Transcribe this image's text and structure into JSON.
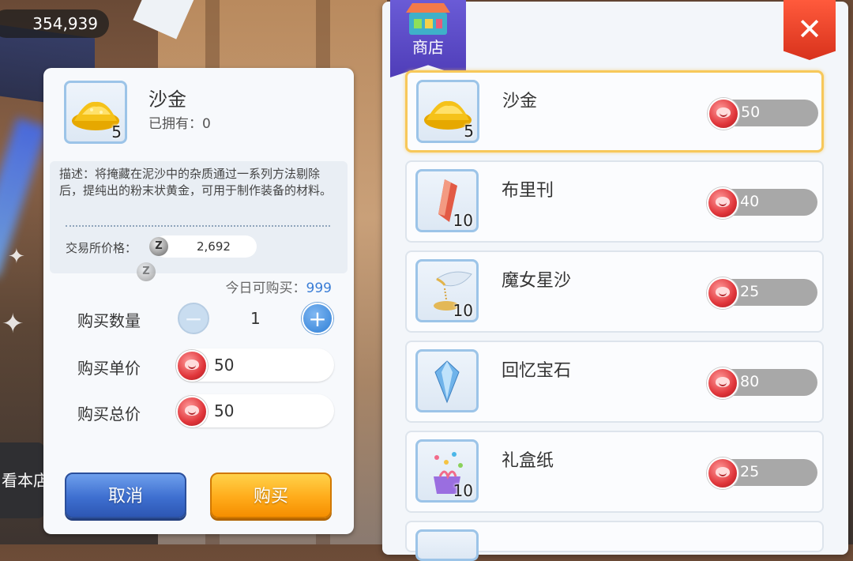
{
  "currency": {
    "amount": "354,939"
  },
  "left_side": {
    "partial_button_label": "看本店"
  },
  "detail": {
    "item_name": "沙金",
    "item_count": "5",
    "owned": "已拥有：0",
    "description": "描述：将掩藏在泥沙中的杂质通过一系列方法剔除后，提纯出的粉末状黄金，可用于制作装备的材料。",
    "exchange_price_label": "交易所价格：",
    "exchange_price_value": "2,692",
    "exchange_coin_icon": "zeny-coin-icon",
    "today_label": "今日可购买：",
    "today_value": "999",
    "qty_label": "购买数量",
    "qty_value": "1",
    "unit_label": "购买单价",
    "unit_value": "50",
    "total_label": "购买总价",
    "total_value": "50",
    "cancel_label": "取消",
    "buy_label": "购买"
  },
  "shop": {
    "tag_label": "商店",
    "close_label": "✕",
    "items": [
      {
        "name": "沙金",
        "count": "5",
        "price": "50",
        "icon": "gold-sand-icon"
      },
      {
        "name": "布里刊",
        "count": "10",
        "price": "40",
        "icon": "red-crystal-icon"
      },
      {
        "name": "魔女星沙",
        "count": "10",
        "price": "25",
        "icon": "hourglass-sand-icon"
      },
      {
        "name": "回忆宝石",
        "count": "",
        "price": "80",
        "icon": "blue-gem-icon"
      },
      {
        "name": "礼盒纸",
        "count": "10",
        "price": "25",
        "icon": "gift-wrap-icon"
      }
    ]
  },
  "colors": {
    "accent_blue": "#3a7dd6",
    "buy_orange": "#ffab1a",
    "cancel_blue": "#3e6fd0",
    "close_red": "#e0351f",
    "selected_border": "#f7c85a",
    "shop_tag_purple": "#5a48c6"
  }
}
